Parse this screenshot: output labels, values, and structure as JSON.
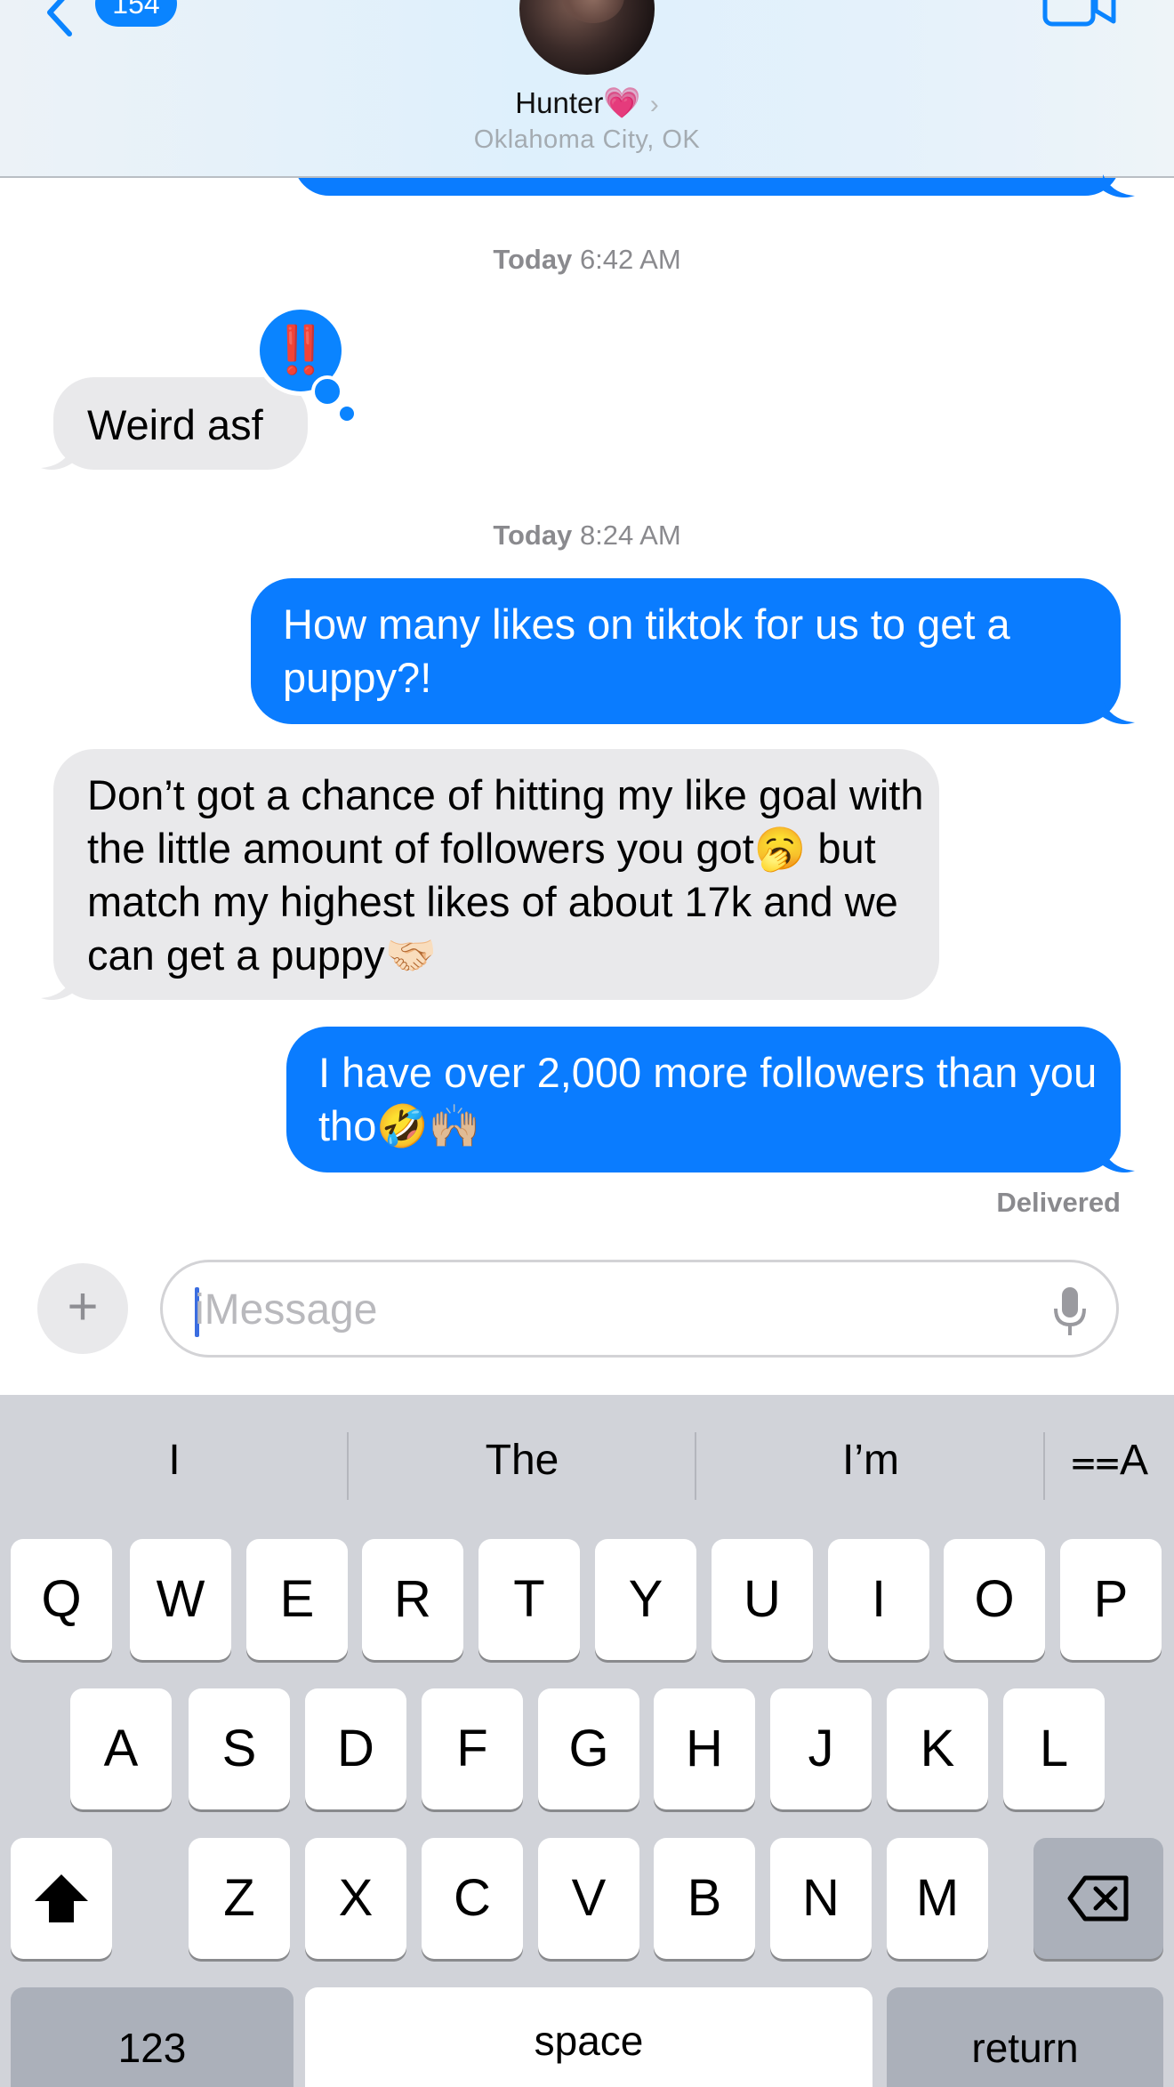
{
  "header": {
    "back_count": "154",
    "contact_name": "Hunter",
    "contact_emoji": "💗",
    "contact_location": "Oklahoma City, OK",
    "icons": {
      "back": "chevron-left-icon",
      "video": "video-camera-icon"
    }
  },
  "messages": {
    "timestamp1": {
      "day": "Today",
      "time": "6:42 AM"
    },
    "msg1": {
      "direction": "incoming",
      "text": "Weird asf",
      "reaction": "‼️"
    },
    "timestamp2": {
      "day": "Today",
      "time": "8:24 AM"
    },
    "msg2": {
      "direction": "outgoing",
      "text": "How many likes on tiktok for us to get a puppy?!"
    },
    "msg3": {
      "direction": "incoming",
      "text": "Don’t got a chance of hitting my like goal with the little amount of followers you got🥱 but match my highest likes of about 17k and we can get a puppy🤝🏻"
    },
    "msg4": {
      "direction": "outgoing",
      "text": "I have over 2,000 more followers than you tho🤣🙌🏼"
    },
    "status": "Delivered"
  },
  "input": {
    "placeholder": "iMessage",
    "icons": {
      "add": "plus-icon",
      "dictation": "microphone-icon"
    }
  },
  "keyboard": {
    "suggestions": [
      "I",
      "The",
      "I’m"
    ],
    "format_label": "⩵A",
    "row1": [
      "Q",
      "W",
      "E",
      "R",
      "T",
      "Y",
      "U",
      "I",
      "O",
      "P"
    ],
    "row2": [
      "A",
      "S",
      "D",
      "F",
      "G",
      "H",
      "J",
      "K",
      "L"
    ],
    "row3": [
      "Z",
      "X",
      "C",
      "V",
      "B",
      "N",
      "M"
    ],
    "numbers_label": "123",
    "space_label": "space",
    "return_label": "return",
    "icons": {
      "shift": "shift-icon",
      "delete": "delete-icon"
    }
  },
  "colors": {
    "imessage_blue": "#0a7cff",
    "incoming_gray": "#e9e9eb",
    "keyboard_bg": "#d1d3d9"
  }
}
